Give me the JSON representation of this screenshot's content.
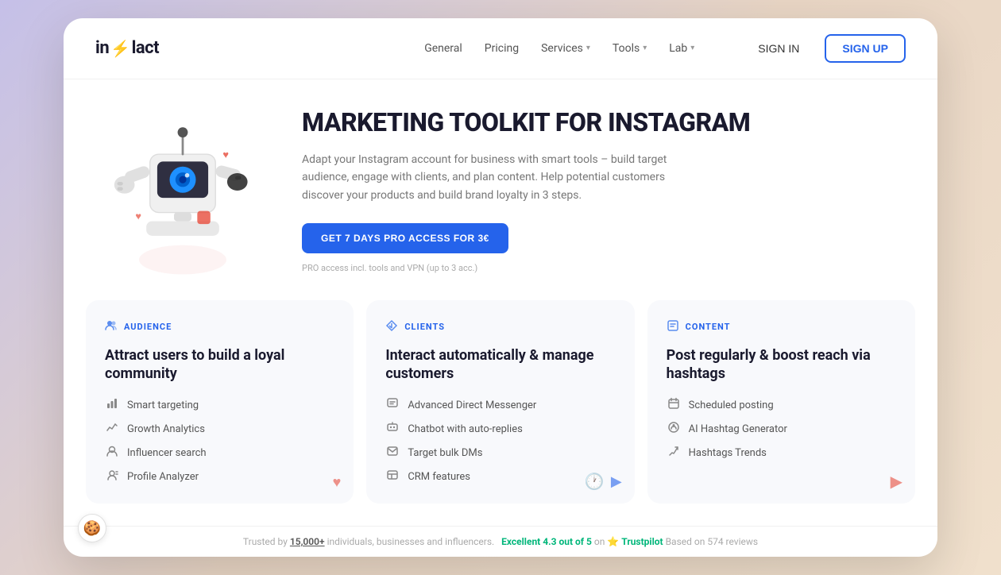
{
  "brand": {
    "name": "inflact",
    "logo_text": "in",
    "logo_lightning": "⚡",
    "logo_suffix": "lact"
  },
  "nav": {
    "links": [
      {
        "label": "General",
        "has_dropdown": false
      },
      {
        "label": "Pricing",
        "has_dropdown": false
      },
      {
        "label": "Services",
        "has_dropdown": true
      },
      {
        "label": "Tools",
        "has_dropdown": true
      },
      {
        "label": "Lab",
        "has_dropdown": true
      }
    ],
    "signin_label": "SIGN IN",
    "signup_label": "SIGN UP"
  },
  "hero": {
    "title": "MARKETING TOOLKIT FOR INSTAGRAM",
    "description": "Adapt your Instagram account for business with smart tools – build target audience, engage with clients, and plan content. Help potential customers discover your products and build brand loyalty in 3 steps.",
    "cta_label": "GET 7 DAYS PRO ACCESS FOR 3€",
    "cta_note": "PRO access incl. tools and VPN (up to 3 acc.)"
  },
  "features": [
    {
      "tag": "AUDIENCE",
      "tag_icon": "👥",
      "title": "Attract users to build a loyal community",
      "items": [
        {
          "icon": "📊",
          "label": "Smart targeting"
        },
        {
          "icon": "📈",
          "label": "Growth Analytics"
        },
        {
          "icon": "🔍",
          "label": "Influencer search"
        },
        {
          "icon": "👤",
          "label": "Profile Analyzer"
        }
      ]
    },
    {
      "tag": "CLIENTS",
      "tag_icon": "🔽",
      "title": "Interact automatically & manage customers",
      "items": [
        {
          "icon": "💬",
          "label": "Advanced Direct Messenger"
        },
        {
          "icon": "🤖",
          "label": "Chatbot with auto-replies"
        },
        {
          "icon": "📨",
          "label": "Target bulk DMs"
        },
        {
          "icon": "📊",
          "label": "CRM features"
        }
      ]
    },
    {
      "tag": "CONTENT",
      "tag_icon": "📋",
      "title": "Post regularly & boost reach via hashtags",
      "items": [
        {
          "icon": "📅",
          "label": "Scheduled posting"
        },
        {
          "icon": "🏷️",
          "label": "AI Hashtag Generator"
        },
        {
          "icon": "📈",
          "label": "Hashtags Trends"
        }
      ]
    }
  ],
  "footer": {
    "trusted_by": "Trusted by",
    "trusted_count": "15,000+",
    "trusted_suffix": "individuals, businesses and influencers.",
    "rating_label": "Excellent 4.3 out of 5",
    "platform": "Trustpilot",
    "reviews": "Based on 574 reviews"
  },
  "cookie": {
    "icon": "🍪"
  }
}
